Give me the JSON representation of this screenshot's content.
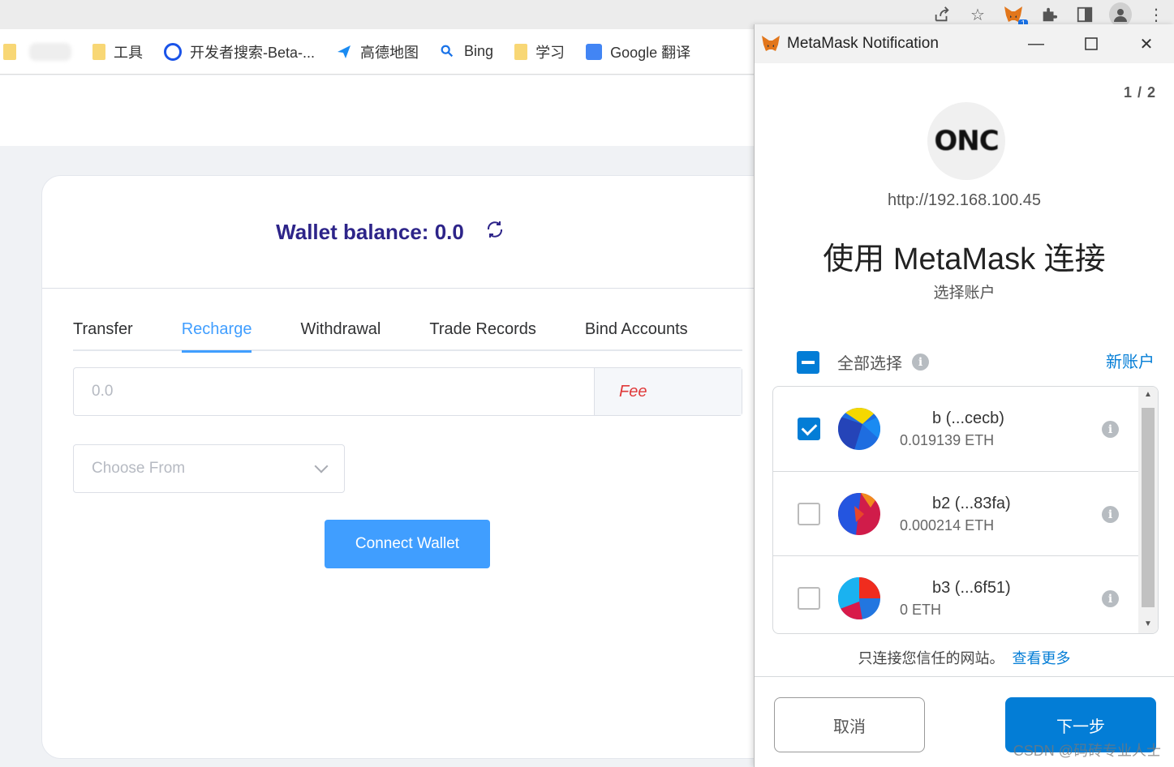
{
  "browser": {
    "bookmarks": [
      {
        "label": "",
        "icon": "folder-icon"
      },
      {
        "label": "工具",
        "icon": "folder-icon"
      },
      {
        "label": "开发者搜索-Beta-...",
        "icon": "devsearch-icon"
      },
      {
        "label": "高德地图",
        "icon": "amap-icon"
      },
      {
        "label": "Bing",
        "icon": "search-icon"
      },
      {
        "label": "学习",
        "icon": "folder-icon"
      },
      {
        "label": "Google 翻译",
        "icon": "translate-icon"
      }
    ],
    "extension_badge": "1"
  },
  "page": {
    "wallet_balance": "Wallet balance: 0.0",
    "tabs": [
      "Transfer",
      "Recharge",
      "Withdrawal",
      "Trade Records",
      "Bind Accounts"
    ],
    "active_tab": "Recharge",
    "amount_placeholder": "0.0",
    "fee_label": "Fee",
    "choose_placeholder": "Choose From",
    "connect_button": "Connect Wallet",
    "colors": {
      "primary": "#409eff",
      "balance": "#2d2489",
      "fee": "#e03a3a"
    }
  },
  "metamask": {
    "window_title": "MetaMask Notification",
    "page_counter": "1 / 2",
    "site_logo_text": "ONC",
    "site_url": "http://192.168.100.45",
    "heading": "使用 MetaMask 连接",
    "subheading": "选择账户",
    "select_all_label": "全部选择",
    "new_account_link": "新账户",
    "accounts": [
      {
        "name": "  b (...cecb)",
        "balance": "0.019139 ETH",
        "checked": true
      },
      {
        "name": "  b2 (...83fa)",
        "balance": "0.000214 ETH",
        "checked": false
      },
      {
        "name": "  b3 (...6f51)",
        "balance": "0 ETH",
        "checked": false
      }
    ],
    "trust_text": "只连接您信任的网站。",
    "learn_more_link": "查看更多",
    "cancel_button": "取消",
    "next_button": "下一步",
    "accent_color": "#037dd6"
  },
  "watermark": "CSDN @码砖专业人士"
}
